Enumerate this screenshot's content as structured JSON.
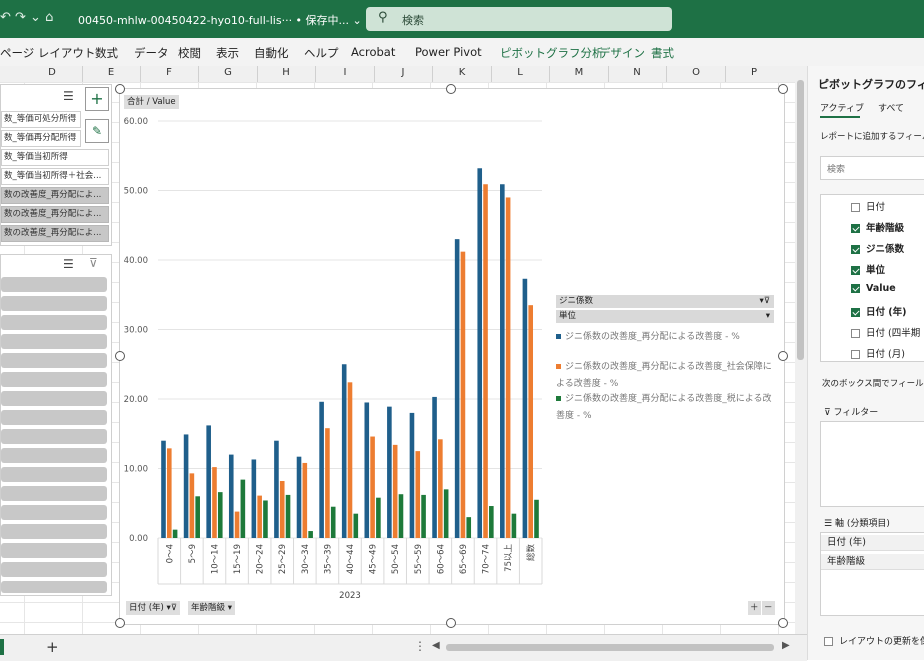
{
  "titlebar": {
    "qat": "↶ ↷ ⌄ ⌂",
    "doc_title": "00450-mhlw-00450422-hyo10-full-lis··· • 保存中... ⌄",
    "search_placeholder": "検索"
  },
  "ribbon": {
    "tabs": [
      "ページ レイアウト",
      "数式",
      "データ",
      "校閲",
      "表示",
      "自動化",
      "ヘルプ",
      "Acrobat",
      "Power Pivot",
      "ピボットグラフ分析",
      "デザイン",
      "書式"
    ]
  },
  "columns": [
    "D",
    "E",
    "F",
    "G",
    "H",
    "I",
    "J",
    "K",
    "L",
    "M",
    "N",
    "O",
    "P"
  ],
  "slicer1": {
    "items": [
      "数_等価可処分所得",
      "数_等価再分配所得",
      "数_等価当初所得",
      "数_等価当初所得＋社会...",
      "数の改善度_再分配によ...",
      "数の改善度_再分配によ...",
      "数の改善度_再分配によ..."
    ]
  },
  "chart": {
    "value_button": "合計 / Value",
    "axis_buttons": [
      "日付 (年)",
      "年齢階級"
    ],
    "legend_header1": "ジニ係数",
    "legend_header2": "単位"
  },
  "chart_data": {
    "type": "bar",
    "categories": [
      "0～4",
      "5～9",
      "10～14",
      "15～19",
      "20～24",
      "25～29",
      "30～34",
      "35～39",
      "40～44",
      "45～49",
      "50～54",
      "55～59",
      "60～64",
      "65～69",
      "70～74",
      "75以上",
      "総数"
    ],
    "group_label": "2023",
    "series": [
      {
        "name": "ジニ係数の改善度_再分配による改善度 - %",
        "color": "#1f5f8b",
        "values": [
          14.0,
          14.9,
          16.2,
          12.0,
          11.3,
          14.0,
          11.7,
          19.6,
          25.0,
          19.5,
          18.9,
          18.0,
          20.3,
          43.0,
          53.2,
          50.9,
          37.3
        ]
      },
      {
        "name": "ジニ係数の改善度_再分配による改善度_社会保障による改善度 - %",
        "color": "#ed7d31",
        "values": [
          12.9,
          9.3,
          10.2,
          3.8,
          6.1,
          8.2,
          10.8,
          15.8,
          22.4,
          14.6,
          13.4,
          12.5,
          14.2,
          41.2,
          50.9,
          49.0,
          33.5
        ]
      },
      {
        "name": "ジニ係数の改善度_再分配による改善度_税による改善度 - %",
        "color": "#1e7a3a",
        "values": [
          1.2,
          6.0,
          6.6,
          8.4,
          5.4,
          6.2,
          1.0,
          4.5,
          3.5,
          5.8,
          6.3,
          6.2,
          7.0,
          3.0,
          4.6,
          3.5,
          5.5
        ]
      }
    ],
    "ylim": [
      0,
      60
    ],
    "yticks": [
      "0.00",
      "10.00",
      "20.00",
      "30.00",
      "40.00",
      "50.00",
      "60.00"
    ]
  },
  "pane": {
    "title": "ピボットグラフのフィール",
    "tab_active": "アクティブ",
    "tab_all": "すべて",
    "add_fields_label": "レポートに追加するフィール",
    "search_placeholder": "検索",
    "fields": [
      {
        "label": "日付",
        "checked": false
      },
      {
        "label": "年齢階級",
        "checked": true
      },
      {
        "label": "ジニ係数",
        "checked": true
      },
      {
        "label": "単位",
        "checked": true
      },
      {
        "label": "Value",
        "checked": true
      },
      {
        "label": "日付 (年)",
        "checked": true
      },
      {
        "label": "日付 (四半期",
        "checked": false
      },
      {
        "label": "日付 (月)",
        "checked": false
      }
    ],
    "drag_label": "次のボックス間でフィールドを",
    "filter_label": "フィルター",
    "axis_label": "軸 (分類項目)",
    "axis_items": [
      "日付 (年)",
      "年齢階級"
    ],
    "defer_label": "レイアウトの更新を保"
  },
  "sheetbar": {
    "add": "+",
    "dots": "⋮"
  }
}
